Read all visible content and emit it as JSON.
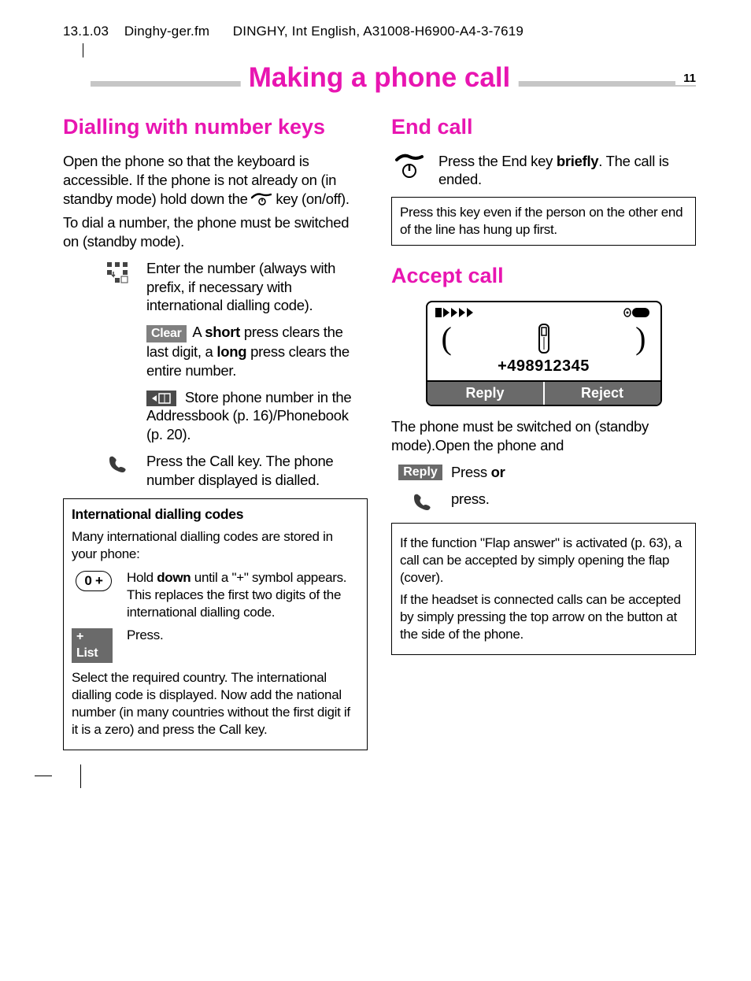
{
  "meta": {
    "date": "13.1.03",
    "file": "Dinghy-ger.fm",
    "doc": "DINGHY, Int English, A31008-H6900-A4-3-7619"
  },
  "page": {
    "title": "Making a phone call",
    "number": "11"
  },
  "left": {
    "h_dialling": "Dialling with number keys",
    "p_open": "Open the phone so that the keyboard is accessible. If the phone is not already on (in standby mode) hold down the ",
    "p_open2": " key (on/off).",
    "p_dial": "To dial a number, the phone must be switched on (standby mode).",
    "enter": "Enter the number (always with prefix, if necessary with international dialling code).",
    "clear_label": "Clear",
    "clear_a": "A ",
    "clear_short": "short",
    "clear_b": " press clears the last digit, a ",
    "clear_long": "long",
    "clear_c": " press clears the entire number.",
    "store": " Store phone number in the Addressbook (p. 16)/Phonebook (p. 20).",
    "callkey": "Press the Call key. The phone number displayed is dialled.",
    "box": {
      "title": "International dialling codes",
      "intro": "Many international dialling codes are stored in your phone:",
      "hold_a": "Hold ",
      "hold_down": "down",
      "hold_b": " until a \"+\" symbol appears. This replaces the first two digits of the international dialling code.",
      "list_label": "+ List",
      "list_press": "Press.",
      "select": "Select the required country. The international dialling code is displayed. Now add the national number (in many countries without the first digit if it is a zero) and press the Call key.",
      "zero_key": "0 +"
    }
  },
  "right": {
    "h_end": "End call",
    "end_a": "Press the End key ",
    "end_brief": "briefly",
    "end_b": ". The call is ended.",
    "end_box": "Press this key even if the person on the other end of the line has hung up first.",
    "h_accept": "Accept call",
    "screen": {
      "number": "+498912345",
      "reply": "Reply",
      "reject": "Reject"
    },
    "p_switched": "The phone must be switched on (standby mode).Open the phone and",
    "reply_label": "Reply",
    "press_or_a": "Press ",
    "press_or_b": "or",
    "press": "press.",
    "box2a": "If the function \"Flap answer\" is activated (p. 63), a call can be accepted by simply opening the flap (cover).",
    "box2b": "If the headset is connected calls can be accepted by simply pressing the top arrow on the button at the side of the phone."
  }
}
